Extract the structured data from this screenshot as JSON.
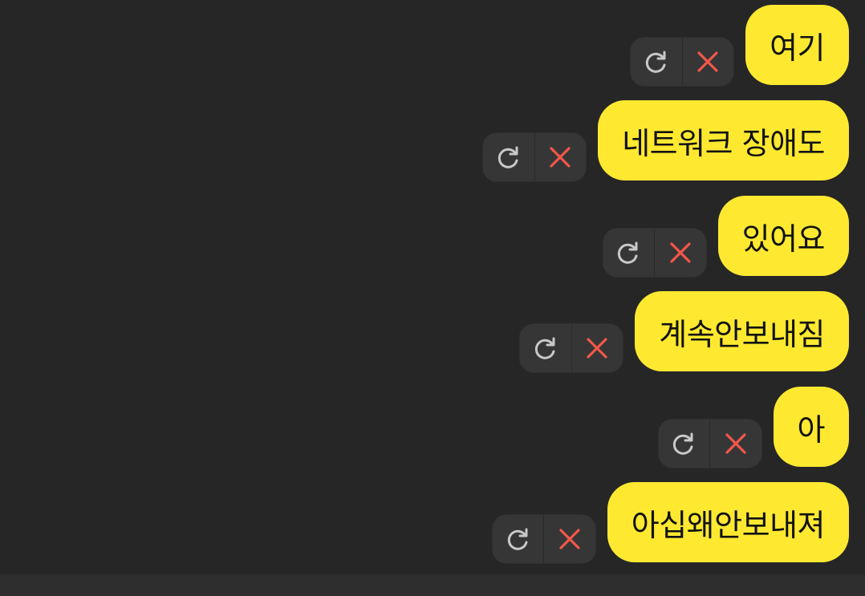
{
  "colors": {
    "background": "#262626",
    "bubble": "#ffe930",
    "bubble_text": "#121212",
    "retry_icon": "#c8c8c8",
    "delete_icon": "#f2574a",
    "control_bg": "#363636"
  },
  "messages": [
    {
      "text": "여기",
      "status": "failed",
      "actions": [
        "retry-icon",
        "delete-icon"
      ]
    },
    {
      "text": "네트워크 장애도",
      "status": "failed",
      "actions": [
        "retry-icon",
        "delete-icon"
      ]
    },
    {
      "text": "있어요",
      "status": "failed",
      "actions": [
        "retry-icon",
        "delete-icon"
      ]
    },
    {
      "text": "계속안보내짐",
      "status": "failed",
      "actions": [
        "retry-icon",
        "delete-icon"
      ]
    },
    {
      "text": "아",
      "status": "failed",
      "actions": [
        "retry-icon",
        "delete-icon"
      ]
    },
    {
      "text": "아십왜안보내져",
      "status": "failed",
      "actions": [
        "retry-icon",
        "delete-icon"
      ]
    }
  ]
}
